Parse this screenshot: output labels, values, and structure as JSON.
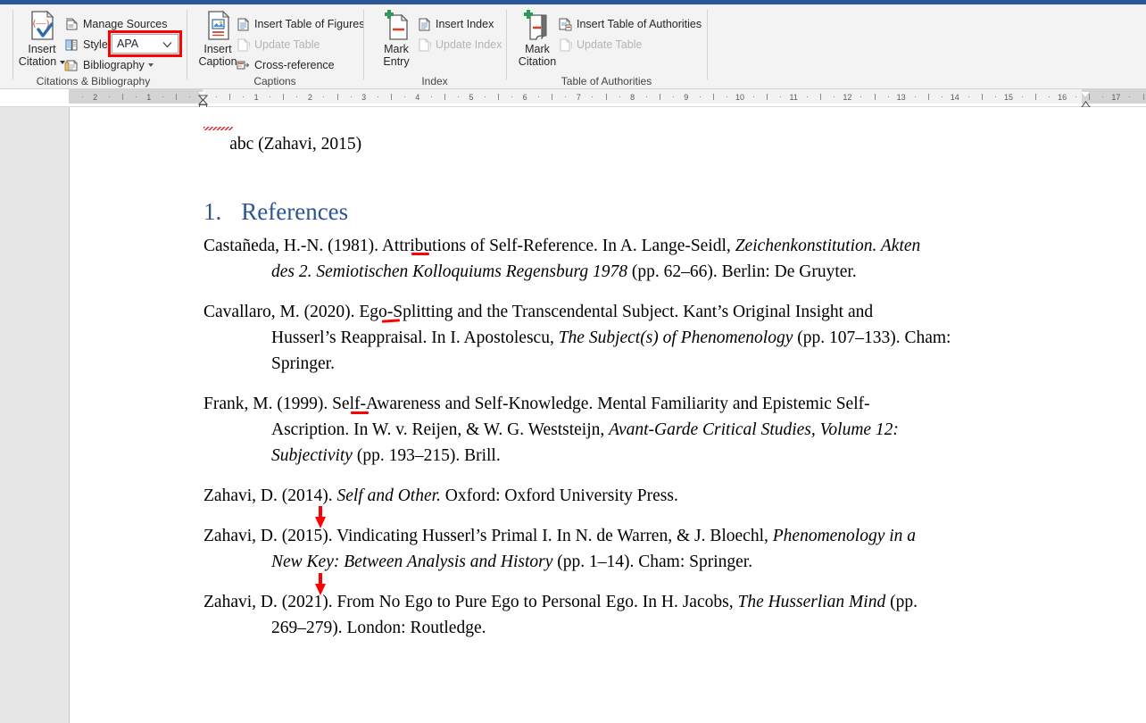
{
  "window": {
    "accent_color": "#2b579a"
  },
  "ribbon": {
    "groups": [
      {
        "id": "citations-bibliography",
        "title": "Citations & Bibliography",
        "big_button": {
          "label_line1": "Insert",
          "label_line2": "Citation",
          "icon": "insert-citation-icon",
          "has_dropdown": true
        },
        "items": [
          {
            "label": "Manage Sources",
            "icon": "manage-sources-icon",
            "disabled": false
          },
          {
            "label": "Style:",
            "icon": "style-icon",
            "disabled": false
          },
          {
            "label": "Bibliography",
            "icon": "bibliography-icon",
            "disabled": false,
            "has_dropdown": true
          }
        ],
        "style_combo": {
          "value": "APA",
          "highlighted": true,
          "highlight_color": "#ff0000"
        }
      },
      {
        "id": "captions",
        "title": "Captions",
        "big_button": {
          "label_line1": "Insert",
          "label_line2": "Caption",
          "icon": "insert-caption-icon",
          "has_dropdown": false
        },
        "items": [
          {
            "label": "Insert Table of Figures",
            "icon": "insert-table-of-figures-icon",
            "disabled": false
          },
          {
            "label": "Update Table",
            "icon": "update-table-icon",
            "disabled": true
          },
          {
            "label": "Cross-reference",
            "icon": "cross-reference-icon",
            "disabled": false
          }
        ]
      },
      {
        "id": "index",
        "title": "Index",
        "big_button": {
          "label_line1": "Mark",
          "label_line2": "Entry",
          "icon": "mark-entry-icon",
          "has_dropdown": false
        },
        "items": [
          {
            "label": "Insert Index",
            "icon": "insert-index-icon",
            "disabled": false
          },
          {
            "label": "Update Index",
            "icon": "update-index-icon",
            "disabled": true
          }
        ]
      },
      {
        "id": "table-of-authorities",
        "title": "Table of Authorities",
        "big_button": {
          "label_line1": "Mark",
          "label_line2": "Citation",
          "icon": "mark-citation-icon",
          "has_dropdown": false
        },
        "items": [
          {
            "label": "Insert Table of Authorities",
            "icon": "insert-table-of-authorities-icon",
            "disabled": false
          },
          {
            "label": "Update Table",
            "icon": "update-table-icon",
            "disabled": true
          }
        ]
      }
    ]
  },
  "ruler": {
    "unit": "cm",
    "left_labels": [
      "2",
      "1"
    ],
    "right_labels": [
      "1",
      "2",
      "3",
      "4",
      "5",
      "6",
      "7",
      "8",
      "9",
      "10",
      "11",
      "12",
      "13",
      "14",
      "15",
      "16",
      "17"
    ],
    "left_indent_position_cm": 0,
    "right_indent_position_cm": 16.2
  },
  "document": {
    "paragraph_above": {
      "text": "abc (Zahavi, 2015)",
      "misspelled_word": "abc"
    },
    "heading": {
      "number": "1.",
      "text": "References",
      "color": "#2e5496"
    },
    "references": [
      {
        "id": "castaneda-1981",
        "lines": [
          [
            {
              "t": "Castañeda, H.-N. (1981). Attributions of Self-Reference. In A. Lange-Seidl, ",
              "i": false
            },
            {
              "t": "Zeichenkonstitution. Akten",
              "i": true
            }
          ],
          [
            {
              "t": "des 2. Semiotischen Kolloquiums Regensburg 1978",
              "i": true
            },
            {
              "t": " (pp. 62–66). Berlin: De Gruyter.",
              "i": false
            }
          ]
        ]
      },
      {
        "id": "cavallaro-2020",
        "lines": [
          [
            {
              "t": "Cavallaro, M. (2020). Ego-Splitting and the Transcendental Subject. Kant’s Original Insight and",
              "i": false
            }
          ],
          [
            {
              "t": "Husserl’s Reappraisal. In I. Apostolescu, ",
              "i": false
            },
            {
              "t": "The Subject(s) of Phenomenology",
              "i": true
            },
            {
              "t": " (pp. 107–133). Cham:",
              "i": false
            }
          ],
          [
            {
              "t": "Springer.",
              "i": false
            }
          ]
        ]
      },
      {
        "id": "frank-1999",
        "lines": [
          [
            {
              "t": "Frank, M. (1999). Self-Awareness and Self-Knowledge. Mental Familiarity and Epistemic Self-",
              "i": false
            }
          ],
          [
            {
              "t": "Ascription. In W. v. Reijen, & W. G. Weststeijn, ",
              "i": false
            },
            {
              "t": "Avant-Garde Critical Studies, Volume 12:",
              "i": true
            }
          ],
          [
            {
              "t": "Subjectivity",
              "i": true
            },
            {
              "t": " (pp. 193–215). Brill.",
              "i": false
            }
          ]
        ]
      },
      {
        "id": "zahavi-2014",
        "lines": [
          [
            {
              "t": "Zahavi, D. (2014). ",
              "i": false
            },
            {
              "t": "Self and Other.",
              "i": true
            },
            {
              "t": " Oxford: Oxford University Press.",
              "i": false
            }
          ]
        ]
      },
      {
        "id": "zahavi-2015",
        "lines": [
          [
            {
              "t": "Zahavi, D. (2015). Vindicating Husserl’s Primal I. In N. de Warren, & J. Bloechl, ",
              "i": false
            },
            {
              "t": "Phenomenology in a",
              "i": true
            }
          ],
          [
            {
              "t": "New Key: Between Analysis and History",
              "i": true
            },
            {
              "t": " (pp. 1–14). Cham: Springer.",
              "i": false
            }
          ]
        ]
      },
      {
        "id": "zahavi-2021",
        "lines": [
          [
            {
              "t": "Zahavi, D. (2021). From No Ego to Pure Ego to Personal Ego. In H. Jacobs, ",
              "i": false
            },
            {
              "t": "The Husserlian Mind",
              "i": true
            },
            {
              "t": " (pp.",
              "i": false
            }
          ],
          [
            {
              "t": "269–279). London: Routledge.",
              "i": false
            }
          ]
        ]
      }
    ],
    "annotations": {
      "color": "#ff0000",
      "underline_marks": 3,
      "down_arrows": 2
    }
  }
}
